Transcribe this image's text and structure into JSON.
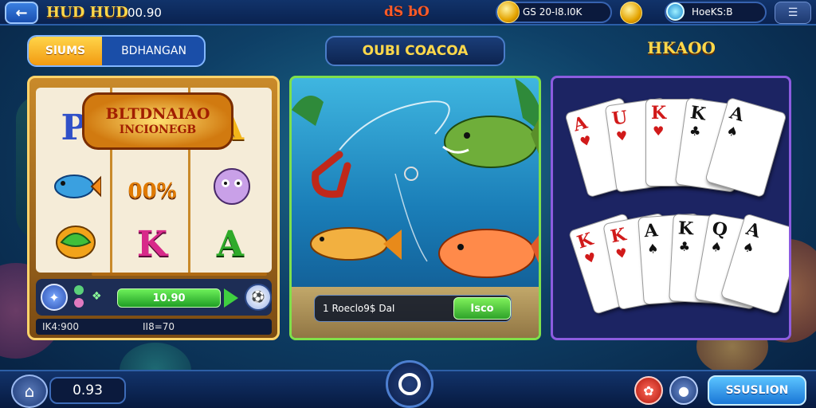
{
  "top_bar": {
    "title": "HUD HUD",
    "score": "00.90",
    "center_label": "dS bO",
    "coins": "GS 20-I8.I0K",
    "gems": "HoeKS:B"
  },
  "tabs": {
    "slots_label": "SlUMS",
    "bonus_label": "BDHANGAN"
  },
  "fishing": {
    "banner": "OUBI COACOA",
    "hud_text": "1 Roeclo9$ DaI",
    "hud_button": "Isco"
  },
  "cards": {
    "banner": "HKAOO",
    "hand_top": [
      {
        "rank": "A",
        "suit": "♥",
        "color": "red"
      },
      {
        "rank": "U",
        "suit": "♥",
        "color": "red"
      },
      {
        "rank": "K",
        "suit": "♥",
        "color": "red"
      },
      {
        "rank": "K",
        "suit": "♣",
        "color": "black"
      },
      {
        "rank": "A",
        "suit": "♠",
        "color": "black"
      }
    ],
    "hand_bottom": [
      {
        "rank": "K",
        "suit": "♥",
        "color": "red"
      },
      {
        "rank": "K",
        "suit": "♥",
        "color": "red"
      },
      {
        "rank": "A",
        "suit": "♠",
        "color": "black"
      },
      {
        "rank": "K",
        "suit": "♣",
        "color": "black"
      },
      {
        "rank": "Q",
        "suit": "♠",
        "color": "black"
      },
      {
        "rank": "A",
        "suit": "♠",
        "color": "black"
      }
    ]
  },
  "slots": {
    "logo_line1": "BLTDNAIAO",
    "logo_line2": "INCIONEGB",
    "reel_symbols": [
      "P",
      "A",
      "00%",
      "K",
      "A"
    ],
    "bet_value": "10.90",
    "footer_left": "IK4:900",
    "footer_right": "II8=70"
  },
  "bottom_bar": {
    "balance": "0.93",
    "action_label": "SSUSLION"
  },
  "colors": {
    "accent_gold": "#ffd84a",
    "slots_frame": "#ffd36a",
    "fishing_frame": "#7fe04a",
    "cards_frame": "#8d5ce0",
    "primary_blue": "#1a76d6"
  }
}
